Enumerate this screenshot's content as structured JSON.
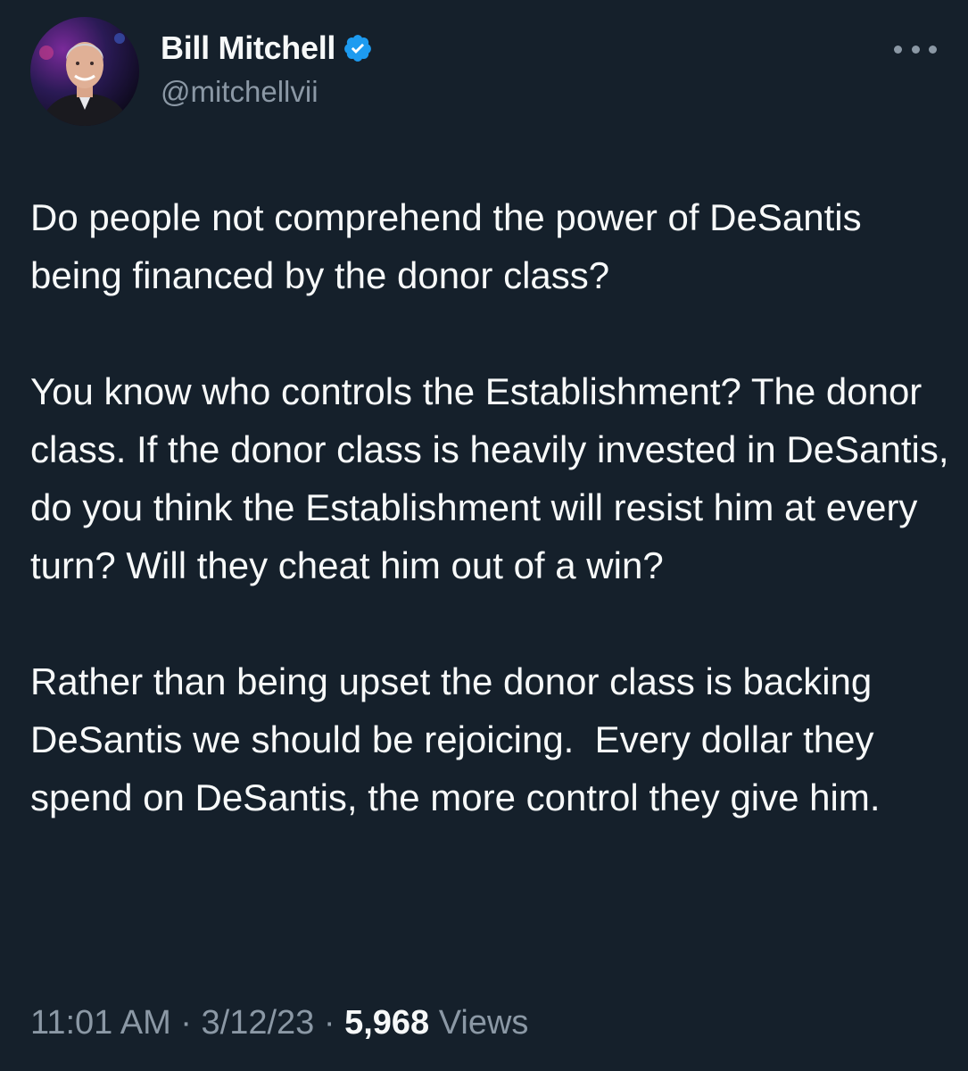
{
  "author": {
    "display_name": "Bill Mitchell",
    "handle": "@mitchellvii",
    "verified": true,
    "verified_color": "#1d9bf0"
  },
  "menu": {
    "icon": "more-horizontal-icon"
  },
  "tweet": {
    "paragraphs": [
      "Do people not comprehend the power of DeSantis being financed by the donor class?",
      "You know who controls the Establishment? The donor class. If the donor class is heavily invested in DeSantis, do you think the Establishment will resist him at every turn? Will they cheat him out of a win?",
      "Rather than being upset the donor class is backing DeSantis we should be rejoicing.  Every dollar they spend on DeSantis, the more control they give him."
    ]
  },
  "meta": {
    "time": "11:01 AM",
    "separator": " · ",
    "date": "3/12/23",
    "views_count": "5,968",
    "views_label": "Views"
  },
  "theme": {
    "background": "#15202b",
    "text": "#f7f9f9",
    "secondary": "#8b98a5"
  }
}
